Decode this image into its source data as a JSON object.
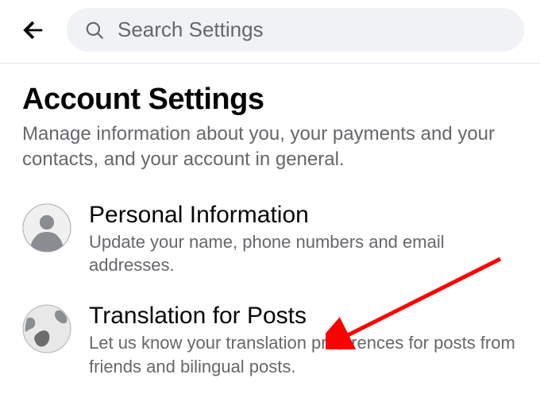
{
  "header": {
    "search_placeholder": "Search Settings"
  },
  "page": {
    "title": "Account Settings",
    "subtitle": "Manage information about you, your payments and your contacts, and your account in general."
  },
  "items": [
    {
      "icon": "person-icon",
      "title": "Personal Information",
      "desc": "Update your name, phone numbers and email addresses."
    },
    {
      "icon": "globe-icon",
      "title": "Translation for Posts",
      "desc": "Let us know your translation preferences for posts from friends and bilingual posts."
    }
  ],
  "annotation": {
    "arrow_target": "translation-for-posts-item"
  }
}
